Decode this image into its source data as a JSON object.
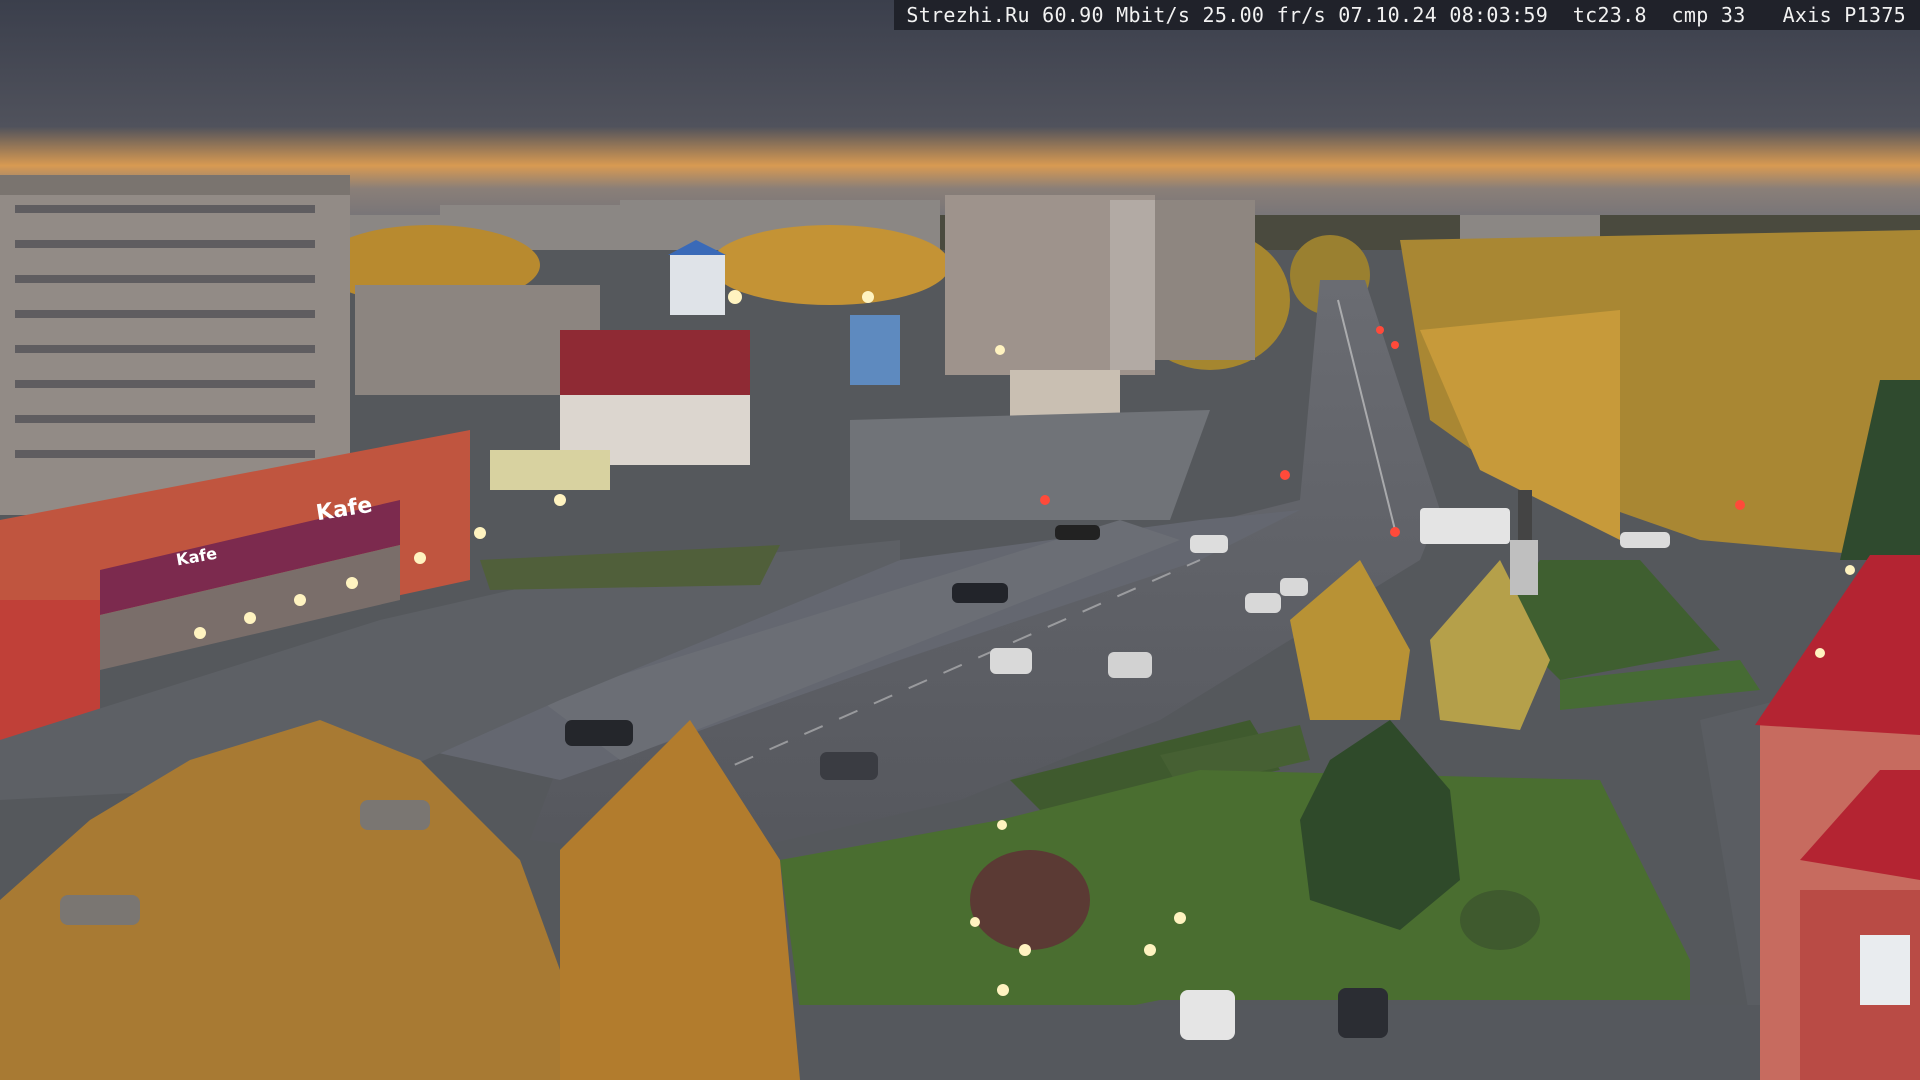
{
  "osd": {
    "text": "Strezhi.Ru 60.90 Mbit/s 25.00 fr/s 07.10.24 08:03:59  tc23.8  cmp 33   Axis P1375"
  },
  "signs": {
    "cafe_large": "Kafe",
    "cafe_small": "Kafe"
  },
  "colors": {
    "sky_top": "#3e4250",
    "sky_glow": "#e6a55a",
    "asphalt": "#5c5f66",
    "grass": "#4a6b33",
    "autumn_foliage": "#c99a3a",
    "building_red": "#b33a3a"
  }
}
